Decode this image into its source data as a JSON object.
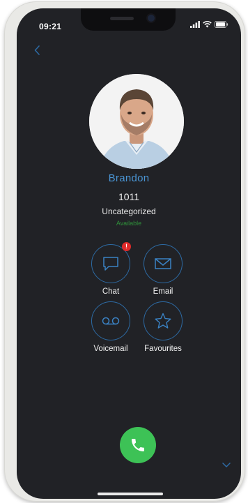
{
  "status_bar": {
    "time": "09:21"
  },
  "contact": {
    "name": "Brandon",
    "extension": "1011",
    "category": "Uncategorized",
    "presence": "Available"
  },
  "actions": [
    {
      "label": "Chat",
      "icon": "chat-bubble-icon",
      "badge": "!"
    },
    {
      "label": "Email",
      "icon": "envelope-icon"
    },
    {
      "label": "Voicemail",
      "icon": "voicemail-icon"
    },
    {
      "label": "Favourites",
      "icon": "star-icon"
    }
  ],
  "colors": {
    "background": "#212226",
    "accent": "#4a95d4",
    "ring": "#2d6aa3",
    "available": "#2f8f3a",
    "call": "#3dc256",
    "badge": "#e02a2a"
  }
}
